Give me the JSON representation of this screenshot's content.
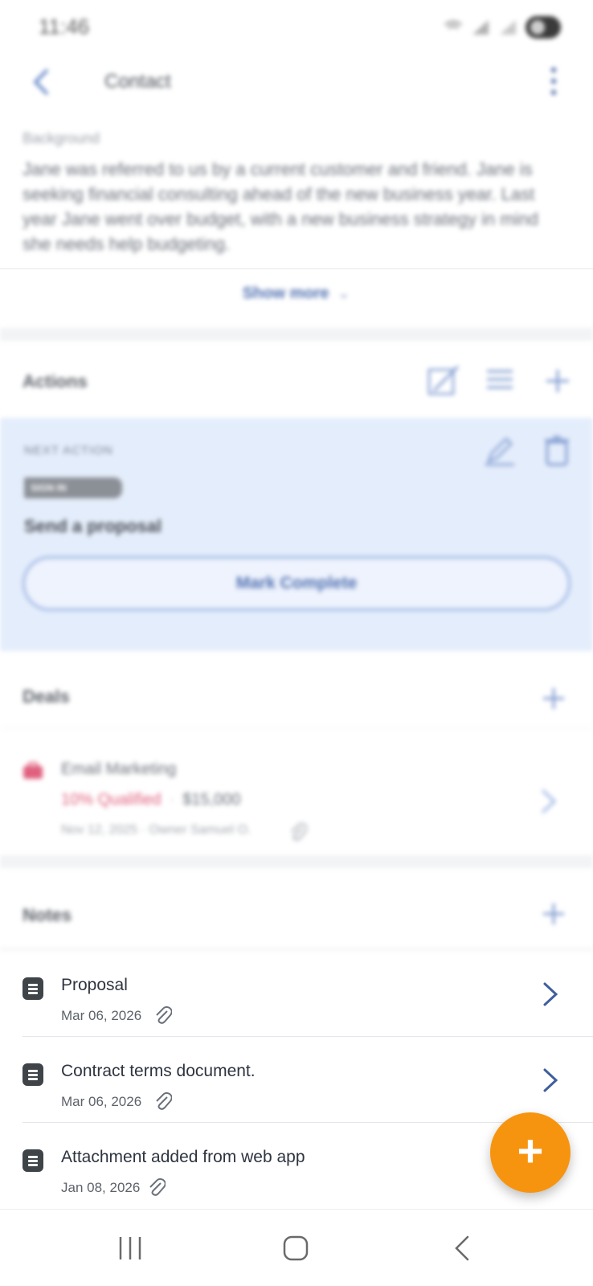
{
  "status_bar": {
    "time": "11:46"
  },
  "app_bar": {
    "title": "Contact"
  },
  "background": {
    "label": "Background",
    "text": "Jane was referred to us by a current customer and friend. Jane is seeking financial consulting ahead of the new business year. Last year Jane went over budget, with a new business strategy in mind she needs help budgeting.",
    "show_more": "Show more"
  },
  "actions": {
    "title": "Actions",
    "next_action_label": "NEXT ACTION",
    "badge": "SIGN IN",
    "next_action_title": "Send a proposal",
    "mark_complete": "Mark Complete"
  },
  "deals": {
    "title": "Deals",
    "items": [
      {
        "name": "Email Marketing",
        "stage": "10% Qualified",
        "separator": "·",
        "amount": "$15,000",
        "meta": "Nov 12, 2025  ·  Owner Samuel O."
      }
    ]
  },
  "notes": {
    "title": "Notes",
    "items": [
      {
        "title": "Proposal",
        "date": "Mar 06, 2026"
      },
      {
        "title": "Contract terms document.",
        "date": "Mar 06, 2026"
      },
      {
        "title": "Attachment added from web app",
        "date": "Jan 08, 2026"
      }
    ]
  },
  "fab": {
    "label": "+"
  },
  "colors": {
    "accent_blue": "#4f6fb0",
    "fab_orange": "#f7940f",
    "deal_stage_pink": "#e0607e",
    "next_action_bg": "#e4edfb"
  },
  "icons": [
    "back-arrow-icon",
    "more-vertical-icon",
    "edit-note-icon",
    "list-icon",
    "plus-icon",
    "pencil-icon",
    "trash-icon",
    "briefcase-icon",
    "paperclip-icon",
    "document-icon",
    "chevron-right-icon",
    "recent-apps-icon",
    "home-icon",
    "nav-back-icon"
  ]
}
